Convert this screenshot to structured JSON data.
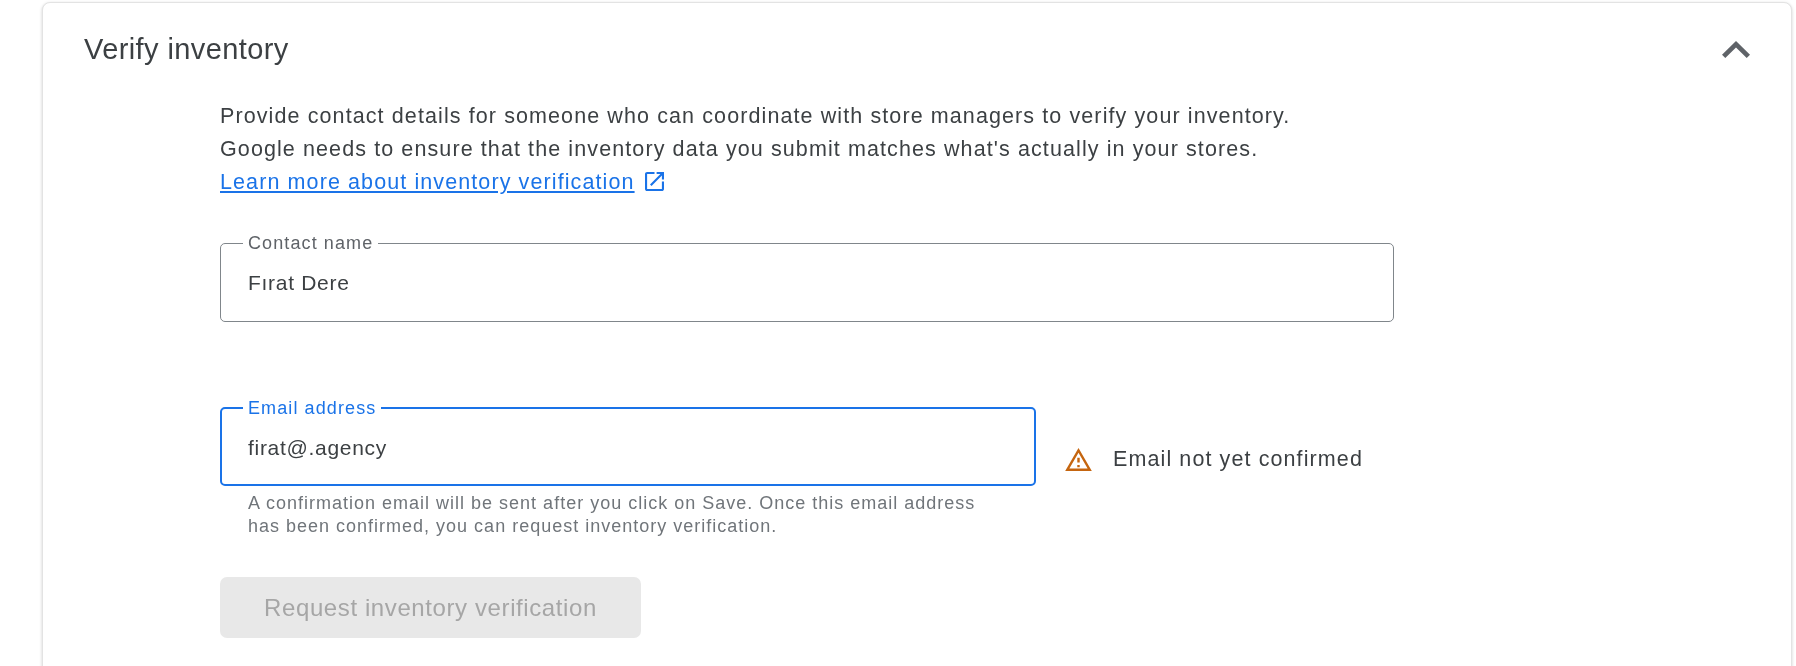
{
  "section": {
    "title": "Verify inventory",
    "expanded": true
  },
  "description": {
    "lines": [
      "Provide contact details for someone who can coordinate with store managers to verify your inventory.",
      "Google needs to ensure that the inventory data you submit matches what's actually in your stores."
    ],
    "link": "Learn more about inventory verification"
  },
  "fields": [
    {
      "label": "Contact name",
      "value": "Fırat Dere",
      "focused": false
    },
    {
      "label": "Email address",
      "value": "firat@.agency",
      "focused": true,
      "status": {
        "kind": "warning",
        "text": "Email not yet confirmed"
      },
      "helper": "A confirmation email will be sent after you click on Save. Once this email address has been confirmed, you can request inventory verification."
    }
  ],
  "button": {
    "label": "Request inventory verification",
    "disabled": true
  }
}
